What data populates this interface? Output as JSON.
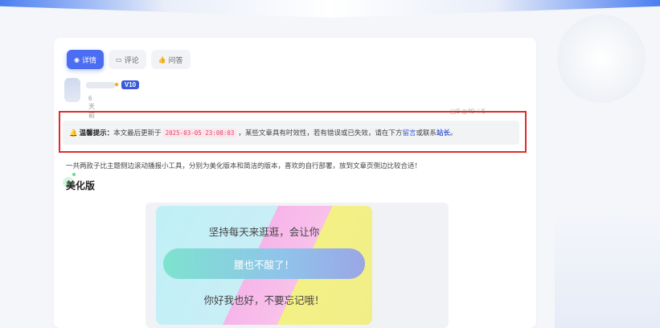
{
  "tabs": [
    {
      "icon": "eye-icon",
      "glyph": "◉",
      "label": "详情"
    },
    {
      "icon": "comment-icon",
      "glyph": "▭",
      "label": "评论"
    },
    {
      "icon": "thumb-icon",
      "glyph": "👍",
      "label": "问答"
    }
  ],
  "author": {
    "level": "V10",
    "published": "6天前发布"
  },
  "stats": {
    "text": "▢0 ◎40 ♡5"
  },
  "notice": {
    "label": "温馨提示：",
    "prefix": "本文最后更新于",
    "date": "2025-03-05 23:08:03",
    "middle": "，某些文章具有时效性，若有错误或已失效，请在下方",
    "link1": "留言",
    "or": "或联系",
    "link2": "站长",
    "end": "。"
  },
  "intro": "一共两款子比主题侧边滚动播报小工具，分别为美化版本和简洁的版本，喜欢的自行部署，放到文章页侧边比较合适！",
  "section_title": "美化版",
  "preview": {
    "line1": "坚持每天来逛逛，会让你",
    "button": "腰也不酸了！",
    "line3": "你好我也好，不要忘记哦！"
  },
  "colors": {
    "accent": "#4b6df1",
    "highlight": "#e02b2b",
    "date": "#e0456a"
  }
}
